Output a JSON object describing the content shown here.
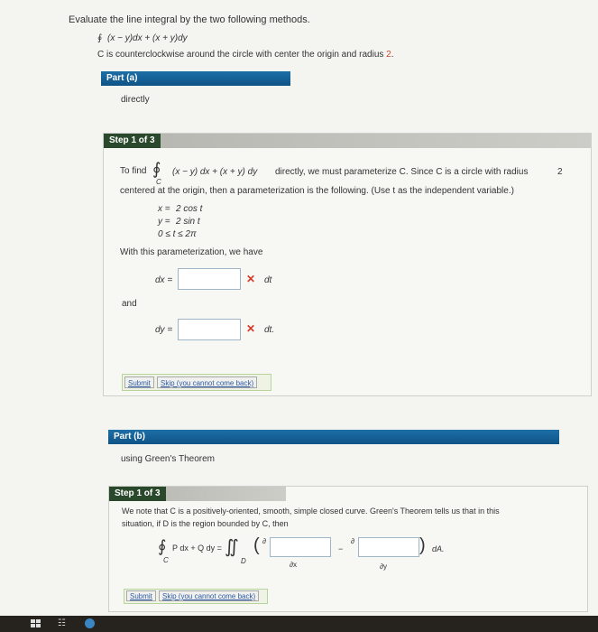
{
  "problem": {
    "instruction": "Evaluate the line integral by the two following methods.",
    "integral_symbol": "∮",
    "integrand": "(x − y)dx + (x + y)dy",
    "desc_prefix": "C is counterclockwise around the circle with center the origin and radius",
    "radius": "2",
    "desc_suffix": "."
  },
  "part_a": {
    "header": "Part (a)",
    "subtitle": "directly",
    "step": {
      "label": "Step 1 of 3",
      "to_find": "To find",
      "sub_c": "C",
      "integrand": "(x − y) dx + (x + y) dy",
      "text1": "directly, we must parameterize C. Since C is a circle with radius",
      "radius": "2",
      "line2": "centered at the origin, then a parameterization is the following. (Use t as the independent variable.)",
      "param_x_lhs": "x =",
      "param_x_rhs": "2 cos t",
      "param_y_lhs": "y =",
      "param_y_rhs": "2 sin t",
      "param_t_range": "0 ≤ t ≤ 2π",
      "with_text": "With this parameterization, we have",
      "dx_label": "dx =",
      "dx_value": "",
      "dx_suffix": "dt",
      "and_text": "and",
      "dy_label": "dy =",
      "dy_value": "",
      "dy_suffix": "dt.",
      "mark": "✕",
      "submit": "Submit",
      "skip": "Skip (you cannot come back)"
    }
  },
  "part_b": {
    "header": "Part (b)",
    "subtitle": "using Green's Theorem",
    "step": {
      "label": "Step 1 of 3",
      "line1": "We note that C is a positively-oriented, smooth, simple closed curve. Green's Theorem tells us that in this",
      "line2": "situation, if D is the region bounded by C, then",
      "lhs": "P dx + Q dy =",
      "sub_c": "C",
      "sub_d": "D",
      "partial": "∂",
      "dx": "∂x",
      "dy": "∂y",
      "minus": "−",
      "da": "dA.",
      "submit": "Submit",
      "skip": "Skip (you cannot come back)"
    }
  }
}
